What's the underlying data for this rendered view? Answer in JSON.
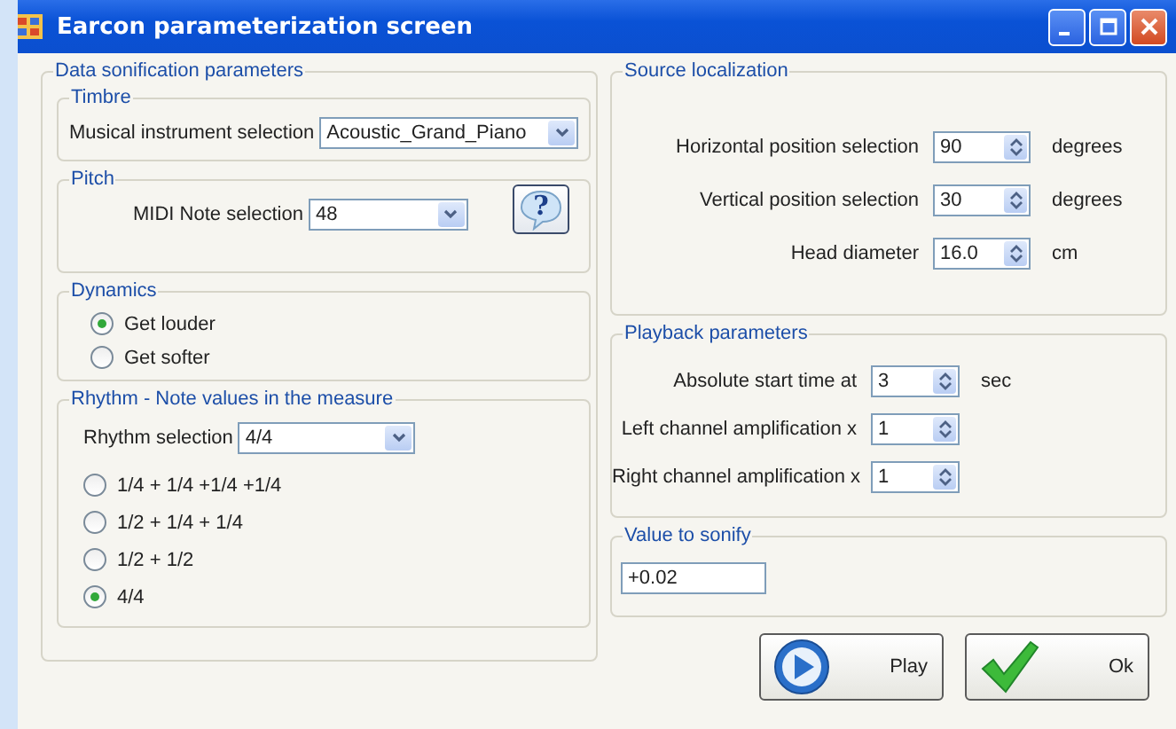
{
  "window": {
    "title": "Earcon parameterization screen"
  },
  "sonification": {
    "title": "Data sonification parameters",
    "timbre": {
      "title": "Timbre",
      "label": "Musical instrument selection",
      "value": "Acoustic_Grand_Piano"
    },
    "pitch": {
      "title": "Pitch",
      "label": "MIDI Note selection",
      "value": "48",
      "help": "?"
    },
    "dynamics": {
      "title": "Dynamics",
      "options": [
        {
          "label": "Get louder",
          "selected": true
        },
        {
          "label": "Get softer",
          "selected": false
        }
      ]
    },
    "rhythm": {
      "title": "Rhythm  - Note values in the measure",
      "label": "Rhythm selection",
      "value": "4/4",
      "options": [
        {
          "label": "1/4 + 1/4 +1/4 +1/4",
          "selected": false
        },
        {
          "label": "1/2 + 1/4 + 1/4",
          "selected": false
        },
        {
          "label": "1/2 + 1/2",
          "selected": false
        },
        {
          "label": "4/4",
          "selected": true
        }
      ]
    }
  },
  "source_localization": {
    "title": "Source localization",
    "fields": [
      {
        "label": "Horizontal position selection",
        "value": "90",
        "unit": "degrees"
      },
      {
        "label": "Vertical position selection",
        "value": "30",
        "unit": "degrees"
      },
      {
        "label": "Head diameter",
        "value": "16.0",
        "unit": "cm"
      }
    ]
  },
  "playback": {
    "title": "Playback parameters",
    "fields": [
      {
        "label": "Absolute start time at",
        "value": "3",
        "unit": "sec"
      },
      {
        "label": "Left channel amplification  x",
        "value": "1"
      },
      {
        "label": "Right channel amplification x",
        "value": "1"
      }
    ]
  },
  "value_to_sonify": {
    "title": "Value to sonify",
    "value": "+0.02"
  },
  "buttons": [
    {
      "label": "Play",
      "kind": "play"
    },
    {
      "label": "Ok",
      "kind": "ok"
    }
  ]
}
